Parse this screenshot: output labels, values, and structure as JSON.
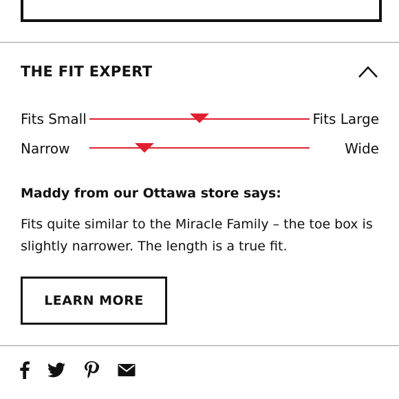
{
  "fit_expert": {
    "title": "THE FIT EXPERT",
    "collapse_icon": "chevron-up-icon",
    "scales": [
      {
        "left_label": "Fits Small",
        "right_label": "Fits Large",
        "value": 0.5
      },
      {
        "left_label": "Narrow",
        "right_label": "Wide",
        "value": 0.25
      }
    ],
    "accent_color": "#e0212f"
  },
  "expert_quote": {
    "heading": "Maddy from our Ottawa store says:",
    "text": "Fits quite similar to the Miracle Family – the toe box is slightly narrower. The length is a true fit."
  },
  "learn_more": {
    "label": "LEARN MORE"
  },
  "share": {
    "icons": [
      "facebook-icon",
      "twitter-icon",
      "pinterest-icon",
      "email-icon"
    ]
  }
}
